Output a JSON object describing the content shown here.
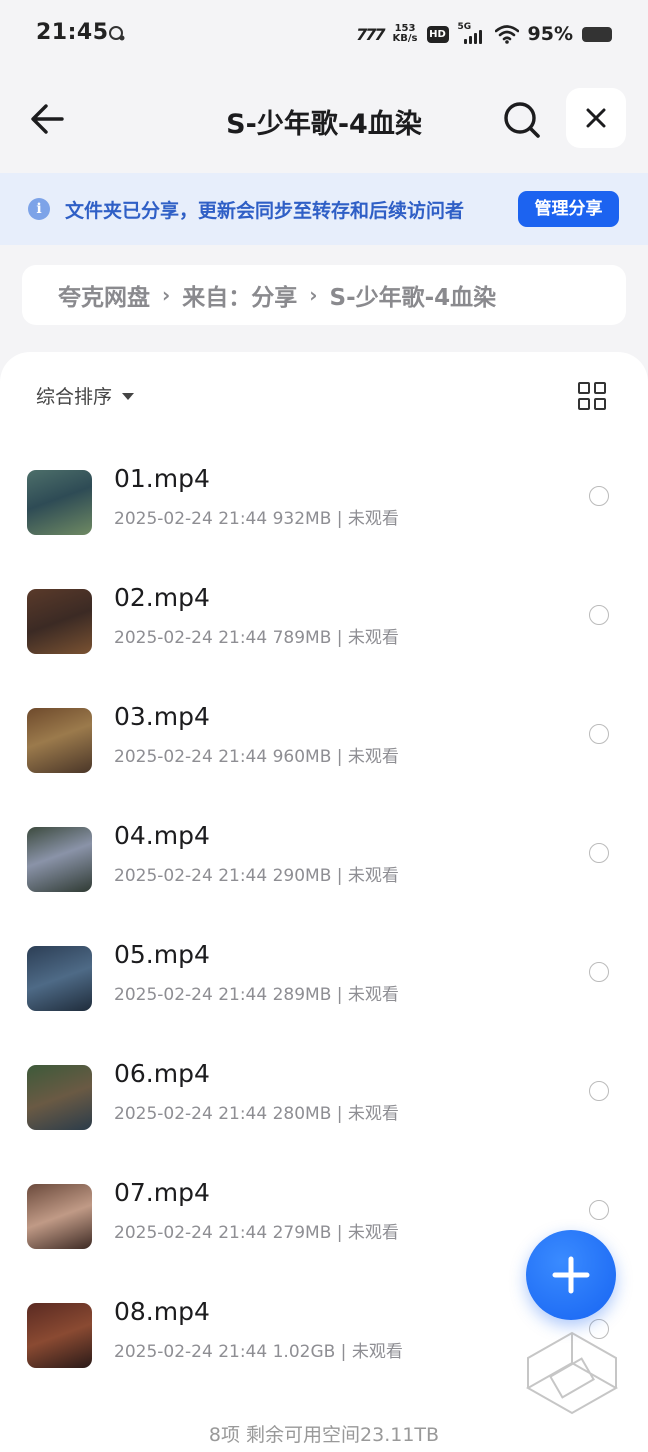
{
  "status_bar": {
    "time": "21:45",
    "network": "777",
    "speed_value": "153",
    "speed_unit": "KB/s",
    "hd": "HD",
    "signal": "5G",
    "battery": "95%"
  },
  "header": {
    "title": "S-少年歌-4血染"
  },
  "banner": {
    "info": "i",
    "text": "文件夹已分享，更新会同步至转存和后续访问者",
    "button": "管理分享"
  },
  "breadcrumb": {
    "items": [
      "夸克网盘",
      "来自：分享",
      "S-少年歌-4血染"
    ],
    "separator": "›"
  },
  "sort": {
    "label": "综合排序"
  },
  "files": [
    {
      "name": "01.mp4",
      "meta": "2025-02-24 21:44  932MB | 未观看"
    },
    {
      "name": "02.mp4",
      "meta": "2025-02-24 21:44  789MB | 未观看"
    },
    {
      "name": "03.mp4",
      "meta": "2025-02-24 21:44  960MB | 未观看"
    },
    {
      "name": "04.mp4",
      "meta": "2025-02-24 21:44  290MB | 未观看"
    },
    {
      "name": "05.mp4",
      "meta": "2025-02-24 21:44  289MB | 未观看"
    },
    {
      "name": "06.mp4",
      "meta": "2025-02-24 21:44  280MB | 未观看"
    },
    {
      "name": "07.mp4",
      "meta": "2025-02-24 21:44  279MB | 未观看"
    },
    {
      "name": "08.mp4",
      "meta": "2025-02-24 21:44  1.02GB | 未观看"
    }
  ],
  "footer": {
    "summary": "8项  剩余可用空间23.11TB"
  },
  "colors": {
    "accent": "#1c63f0",
    "banner_bg": "#e7eefb",
    "banner_text": "#2f5fc6",
    "page_bg": "#f4f4f6"
  }
}
